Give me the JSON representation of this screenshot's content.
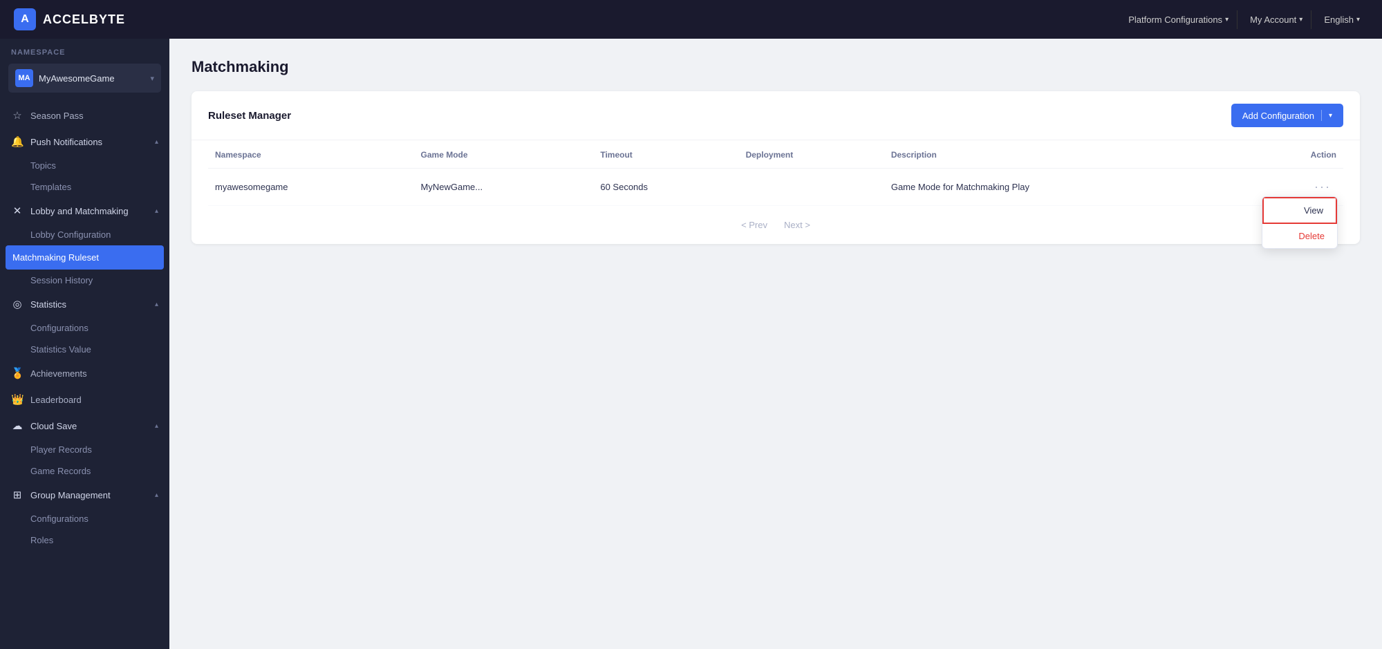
{
  "topnav": {
    "logo_letter": "A",
    "logo_text": "ACCELBYTE",
    "platform_configurations_label": "Platform Configurations",
    "my_account_label": "My Account",
    "english_label": "English"
  },
  "sidebar": {
    "namespace_label": "NAMESPACE",
    "namespace_avatar": "MA",
    "namespace_name": "MyAwesomeGame",
    "items": [
      {
        "id": "season-pass",
        "label": "Season Pass",
        "icon": "☆",
        "type": "item"
      },
      {
        "id": "push-notifications",
        "label": "Push Notifications",
        "icon": "🔔",
        "type": "section",
        "expanded": true,
        "children": [
          {
            "id": "topics",
            "label": "Topics"
          },
          {
            "id": "templates",
            "label": "Templates"
          }
        ]
      },
      {
        "id": "lobby-matchmaking",
        "label": "Lobby and Matchmaking",
        "icon": "✕",
        "type": "section",
        "expanded": true,
        "children": [
          {
            "id": "lobby-configuration",
            "label": "Lobby Configuration"
          },
          {
            "id": "matchmaking-ruleset",
            "label": "Matchmaking Ruleset",
            "active": true
          },
          {
            "id": "session-history",
            "label": "Session History"
          }
        ]
      },
      {
        "id": "statistics",
        "label": "Statistics",
        "icon": "◎",
        "type": "section",
        "expanded": true,
        "children": [
          {
            "id": "configurations",
            "label": "Configurations"
          },
          {
            "id": "statistics-value",
            "label": "Statistics Value"
          }
        ]
      },
      {
        "id": "achievements",
        "label": "Achievements",
        "icon": "🏅",
        "type": "item"
      },
      {
        "id": "leaderboard",
        "label": "Leaderboard",
        "icon": "👑",
        "type": "item"
      },
      {
        "id": "cloud-save",
        "label": "Cloud Save",
        "icon": "☁",
        "type": "section",
        "expanded": true,
        "children": [
          {
            "id": "player-records",
            "label": "Player Records"
          },
          {
            "id": "game-records",
            "label": "Game Records"
          }
        ]
      },
      {
        "id": "group-management",
        "label": "Group Management",
        "icon": "⊞",
        "type": "section",
        "expanded": true,
        "children": [
          {
            "id": "gm-configurations",
            "label": "Configurations"
          },
          {
            "id": "roles",
            "label": "Roles"
          }
        ]
      }
    ]
  },
  "main": {
    "page_title": "Matchmaking",
    "card_title": "Ruleset Manager",
    "add_config_label": "Add Configuration",
    "table": {
      "columns": [
        "Namespace",
        "Game Mode",
        "Timeout",
        "Deployment",
        "Description",
        "Action"
      ],
      "rows": [
        {
          "namespace": "myawesomegame",
          "game_mode": "MyNewGame...",
          "timeout": "60 Seconds",
          "deployment": "",
          "description": "Game Mode for Matchmaking Play"
        }
      ]
    },
    "pagination": {
      "prev_label": "< Prev",
      "next_label": "Next >"
    },
    "action_menu": {
      "view_label": "View",
      "delete_label": "Delete"
    }
  }
}
